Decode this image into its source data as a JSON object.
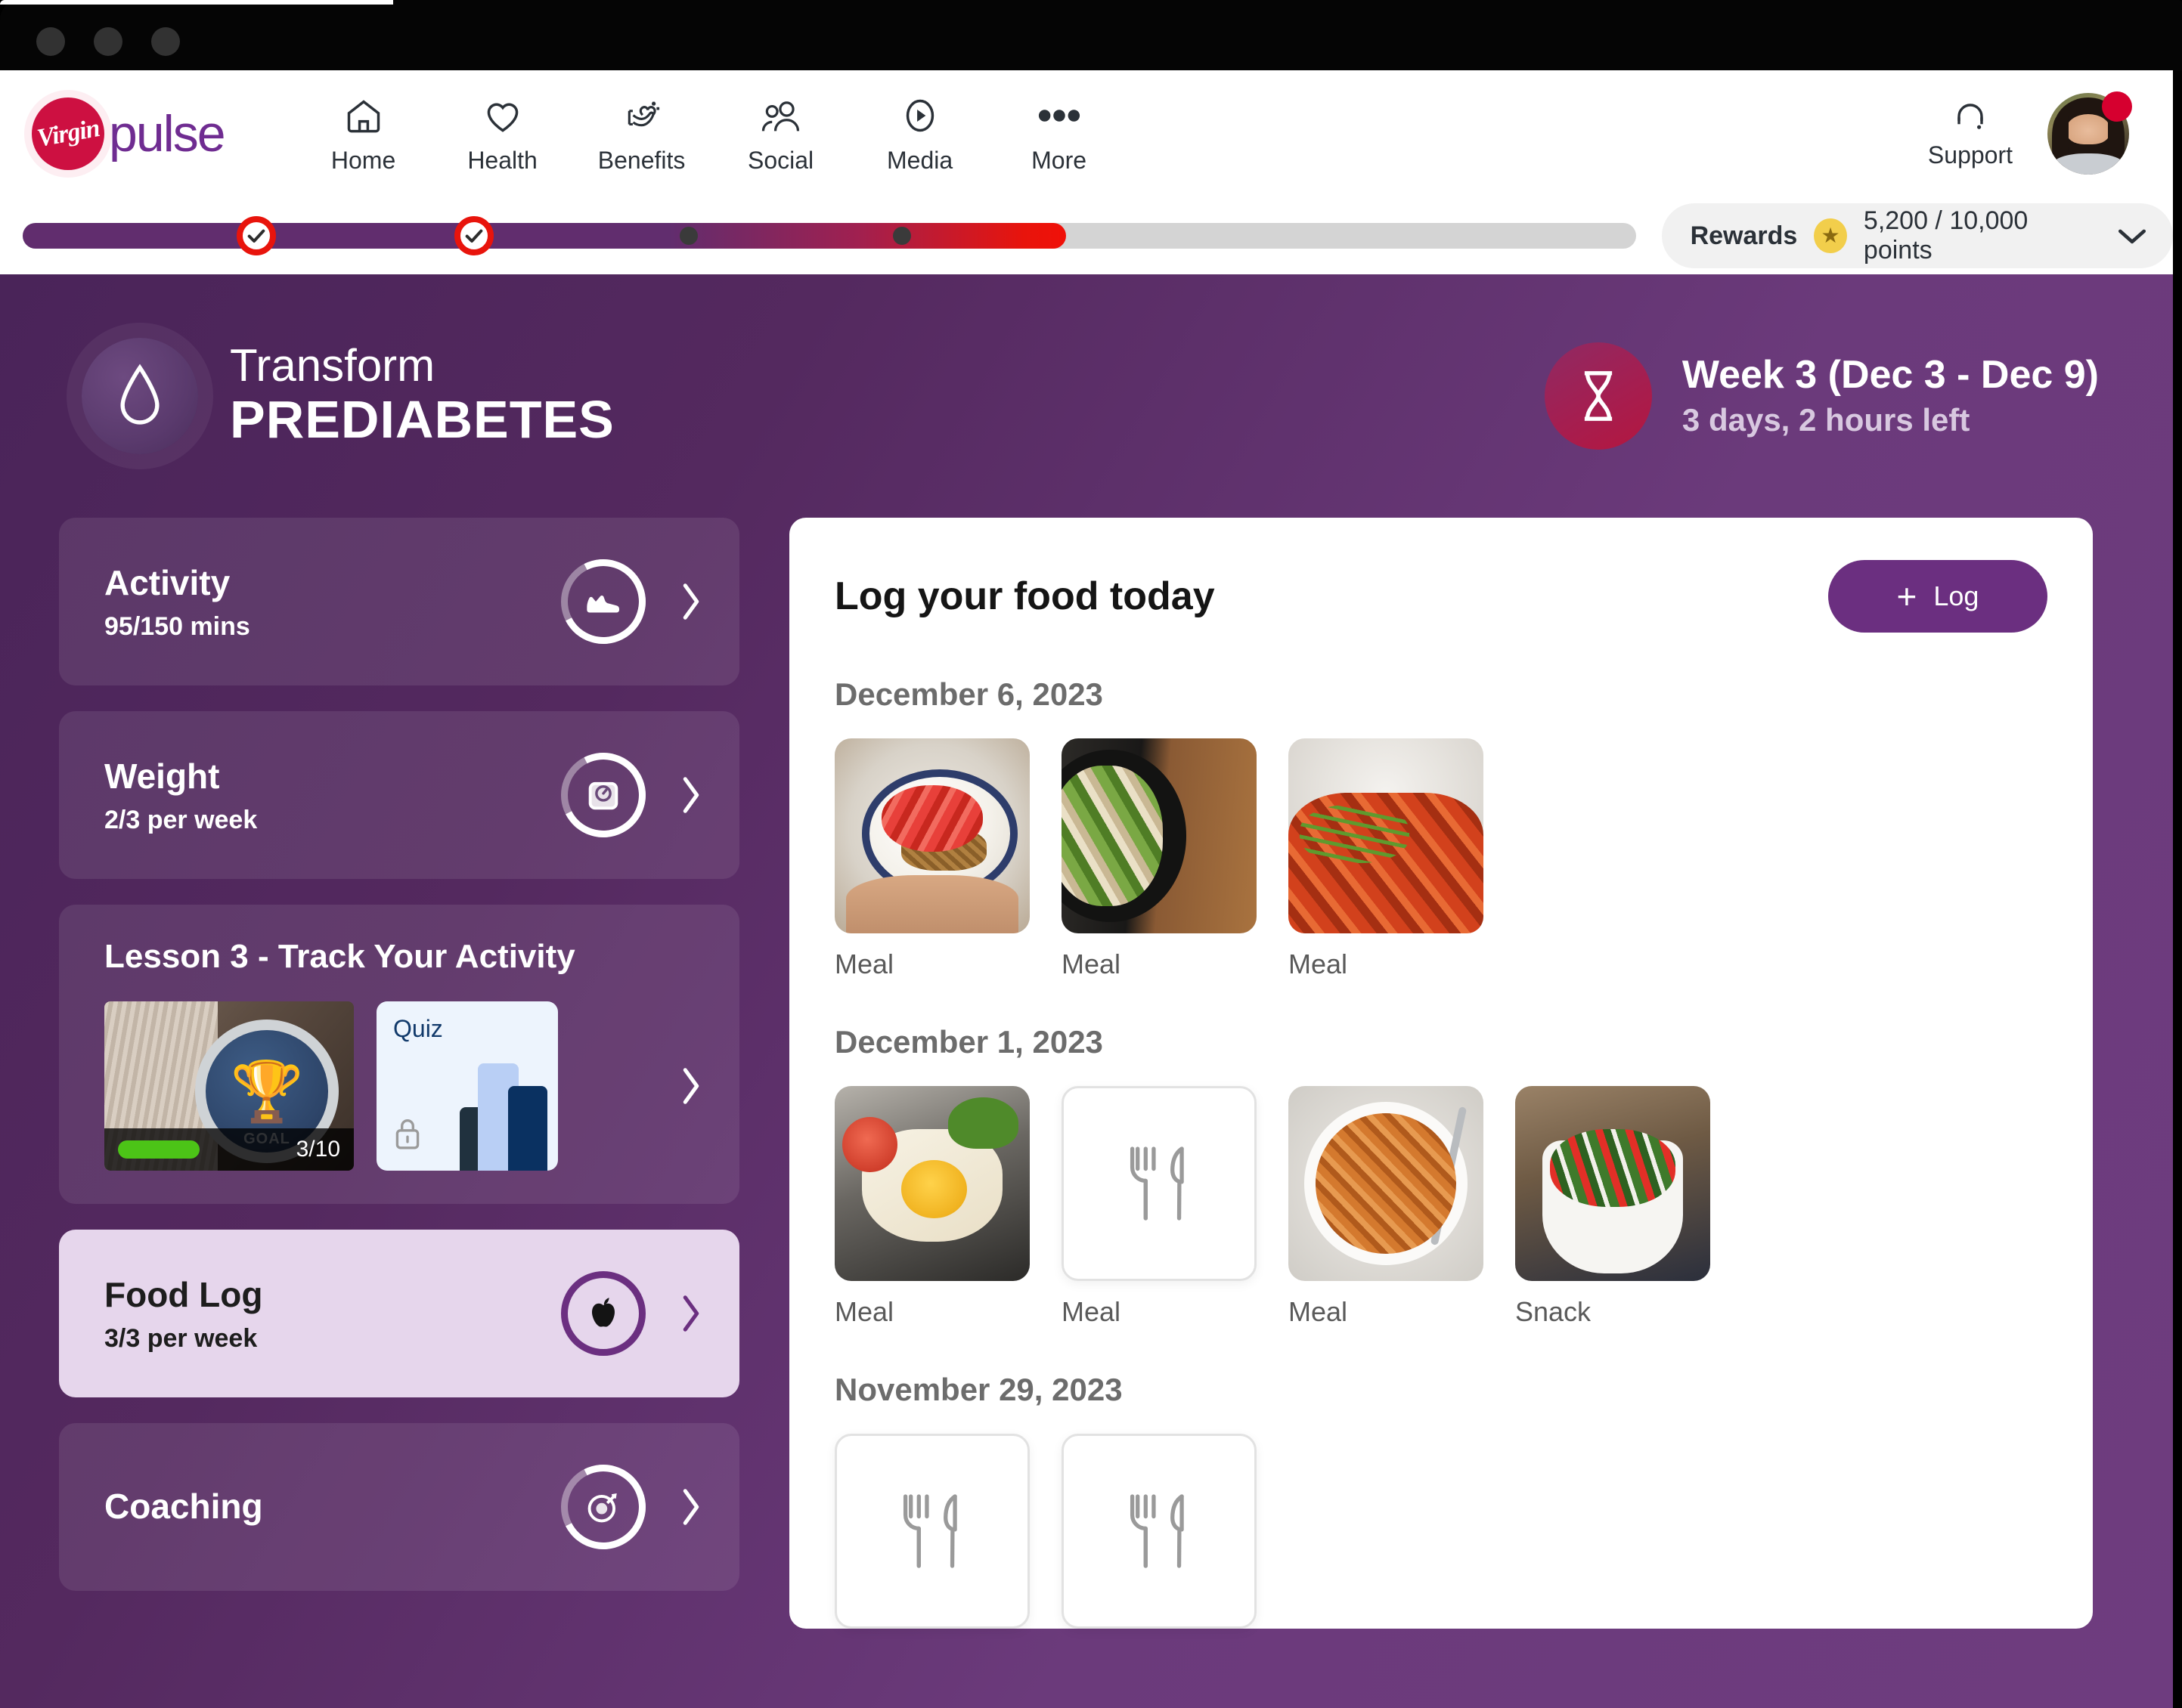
{
  "window": {
    "traffic_lights": [
      "close",
      "minimize",
      "maximize"
    ]
  },
  "topnav": {
    "brand": {
      "mark_text": "Virgin",
      "word": "pulse"
    },
    "items": [
      {
        "label": "Home",
        "icon": "home-icon"
      },
      {
        "label": "Health",
        "icon": "heart-icon"
      },
      {
        "label": "Benefits",
        "icon": "hand-sparkle-icon"
      },
      {
        "label": "Social",
        "icon": "people-icon"
      },
      {
        "label": "Media",
        "icon": "play-circle-icon"
      },
      {
        "label": "More",
        "icon": "ellipsis-icon"
      }
    ],
    "support": {
      "label": "Support",
      "icon": "headset-icon"
    },
    "avatar": {
      "name": "user-avatar",
      "has_notification": true
    }
  },
  "rewards": {
    "label": "Rewards",
    "points_text": "5,200 / 10,000 points",
    "earned": 5200,
    "total": 10000,
    "star_icon": "star-icon",
    "chevron": "chevron-down-icon"
  },
  "progress_bar": {
    "fill_percent": 62,
    "checkpoints_percent": [
      14.5,
      28
    ],
    "dots_percent": [
      41.3,
      54.5
    ],
    "colors": {
      "fill_start": "#612D6E",
      "fill_end": "#F01008",
      "track": "#d4d4d4",
      "marker": "#E8140C"
    }
  },
  "program_header": {
    "eyebrow": "Transform",
    "title": "PREDIABETES",
    "icon": "water-drop-icon",
    "week_title": "Week 3 (Dec 3 - Dec 9)",
    "week_sub": "3 days, 2 hours left",
    "timer_icon": "hourglass-icon"
  },
  "sidebar": {
    "cards": [
      {
        "title": "Activity",
        "sub": "95/150 mins",
        "icon": "shoe-icon",
        "active": false,
        "chevron": "chevron-right-icon"
      },
      {
        "title": "Weight",
        "sub": "2/3 per week",
        "icon": "scale-icon",
        "active": false,
        "chevron": "chevron-right-icon"
      }
    ],
    "lesson": {
      "title": "Lesson 3 - Track Your Activity",
      "thumb": {
        "progress_text": "3/10",
        "alt": "smartwatch-goal-trophy",
        "badge_icon": "trophy-icon",
        "watch_label": "GOAL"
      },
      "quiz": {
        "label": "Quiz",
        "lock_icon": "lock-icon",
        "chart_icon": "bar-chart-icon"
      },
      "chevron": "chevron-right-icon"
    },
    "cards_lower": [
      {
        "title": "Food Log",
        "sub": "3/3 per week",
        "icon": "apple-icon",
        "active": true,
        "chevron": "chevron-right-icon"
      },
      {
        "title": "Coaching",
        "sub": "",
        "icon": "target-icon",
        "active": false,
        "chevron": "chevron-right-icon"
      }
    ]
  },
  "food_log": {
    "title": "Log your food today",
    "log_button": {
      "label": "Log",
      "icon": "plus-icon"
    },
    "empty_icon": "fork-knife-icon",
    "groups": [
      {
        "date": "December 6, 2023",
        "entries": [
          {
            "label": "Meal",
            "photo": "berry-yogurt-bowl",
            "empty": false
          },
          {
            "label": "Meal",
            "photo": "chicken-caesar-skillet",
            "empty": false
          },
          {
            "label": "Meal",
            "photo": "noodles-tomato",
            "empty": false
          }
        ]
      },
      {
        "date": "December 1, 2023",
        "entries": [
          {
            "label": "Meal",
            "photo": "egg-toast-bacon",
            "empty": false
          },
          {
            "label": "Meal",
            "photo": "",
            "empty": true
          },
          {
            "label": "Meal",
            "photo": "fusilli-pasta",
            "empty": false
          },
          {
            "label": "Snack",
            "photo": "strawberry-spinach-salad",
            "empty": false
          }
        ]
      },
      {
        "date": "November 29, 2023",
        "entries": [
          {
            "label": "",
            "photo": "",
            "empty": true
          },
          {
            "label": "",
            "photo": "",
            "empty": true
          }
        ]
      }
    ]
  },
  "colors": {
    "brand_purple": "#6B2F80",
    "brand_red": "#CD1041",
    "body_purple": "#54295f",
    "accent_red": "#E8140C",
    "active_card": "#E6D6EC"
  }
}
